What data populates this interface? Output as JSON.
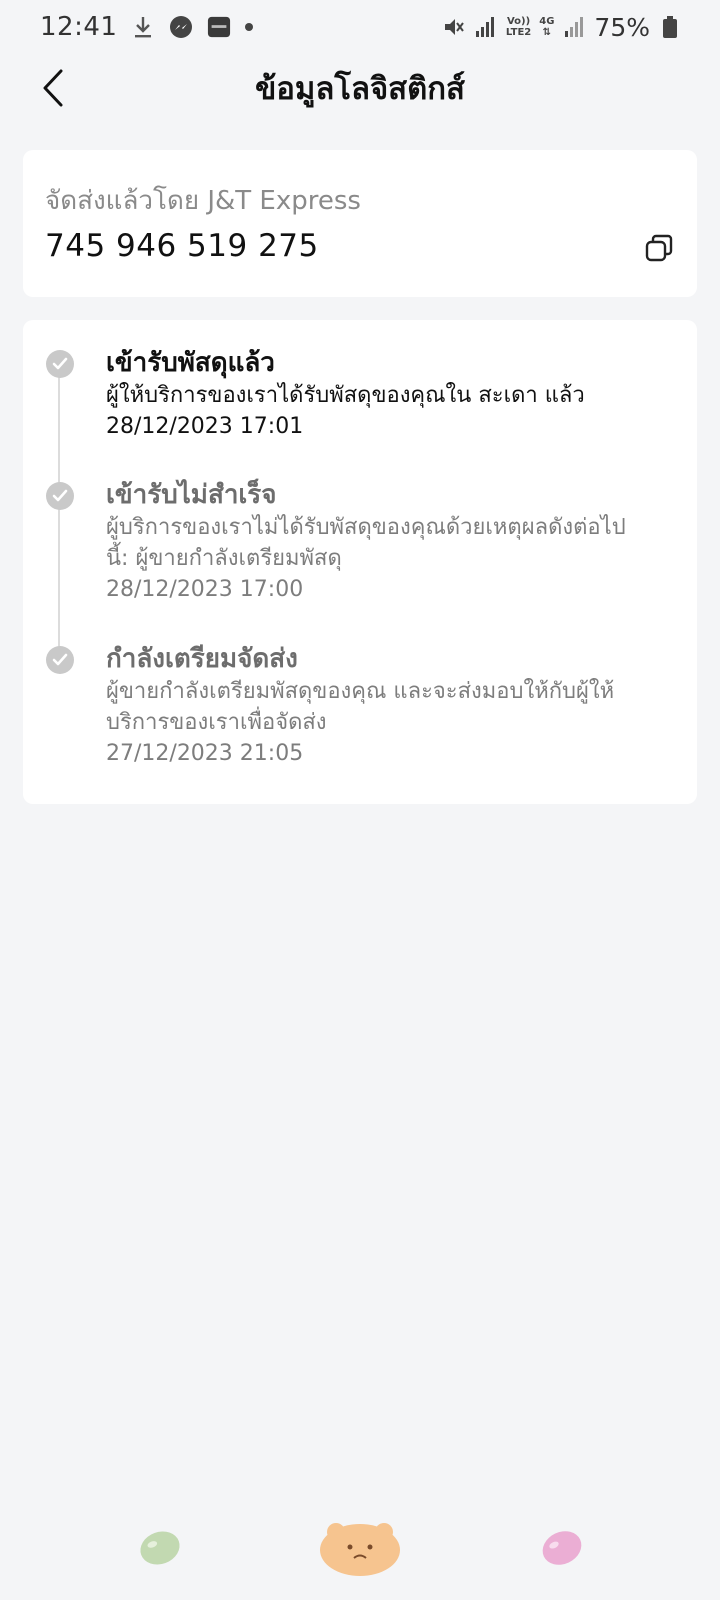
{
  "status_bar": {
    "time": "12:41",
    "battery": "75%",
    "network_top": "Vo))",
    "network_bottom": "LTE2",
    "network_4g": "4G"
  },
  "header": {
    "title": "ข้อมูลโลจิสติกส์"
  },
  "tracking": {
    "carrier_label": "จัดส่งแล้วโดย J&T Express",
    "number": "745 946 519 275"
  },
  "timeline": [
    {
      "title": "เข้ารับพัสดุแล้ว",
      "desc_line1": "ผู้ให้บริการของเราได้รับพัสดุของคุณใน สะเดา แล้ว",
      "desc_line2": "",
      "time": "28/12/2023 17:01"
    },
    {
      "title": "เข้ารับไม่สำเร็จ",
      "desc_line1": "ผู้บริการของเราไม่ได้รับพัสดุของคุณด้วยเหตุผลดังต่อไป",
      "desc_line2": "นี้: ผู้ขายกำลังเตรียมพัสดุ",
      "time": "28/12/2023 17:00"
    },
    {
      "title": "กำลังเตรียมจัดส่ง",
      "desc_line1": "ผู้ขายกำลังเตรียมพัสดุของคุณ และจะส่งมอบให้กับผู้ให้",
      "desc_line2": "บริการของเราเพื่อจัดส่ง",
      "time": "27/12/2023 21:05"
    }
  ],
  "colors": {
    "background": "#f4f5f7",
    "card": "#ffffff",
    "muted_text": "#7d7d7d",
    "timeline_dot": "#c9c9c9",
    "bean_green": "#b8d3a5",
    "bear_orange": "#f6c48f",
    "bean_pink": "#eaa6cf"
  }
}
